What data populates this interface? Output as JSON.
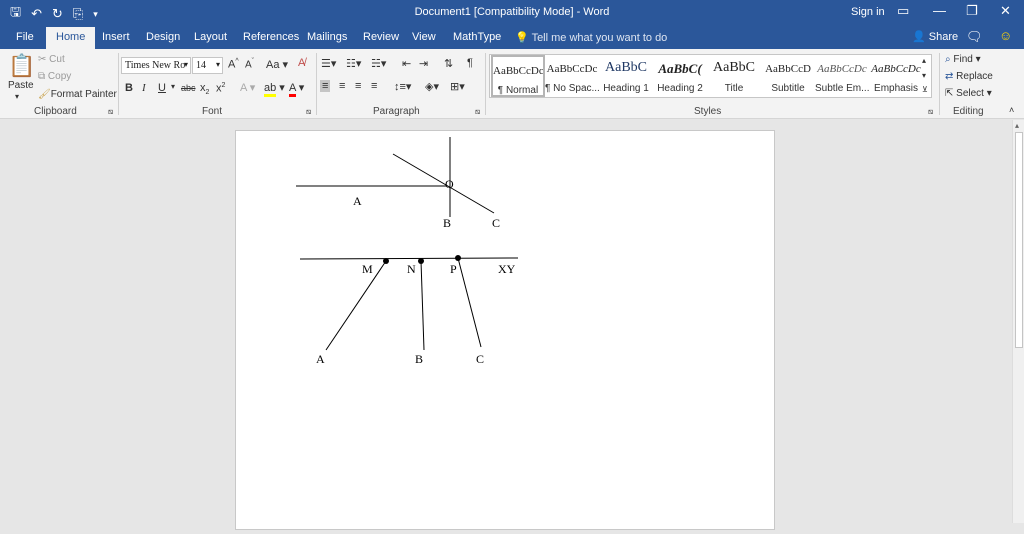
{
  "window": {
    "title": "Document1 [Compatibility Mode] - Word",
    "sign_in": "Sign in",
    "share": "Share",
    "tell_me": "Tell me what you want to do"
  },
  "tabs": [
    "File",
    "Home",
    "Insert",
    "Design",
    "Layout",
    "References",
    "Mailings",
    "Review",
    "View",
    "MathType"
  ],
  "clipboard": {
    "paste": "Paste",
    "cut": "Cut",
    "copy": "Copy",
    "format_painter": "Format Painter",
    "label": "Clipboard"
  },
  "font": {
    "name": "Times New Ro",
    "size": "14",
    "case": "Aa",
    "label": "Font"
  },
  "paragraph": {
    "label": "Paragraph"
  },
  "styles": {
    "label": "Styles",
    "items": [
      {
        "sample": "AaBbCcDc",
        "name": "¶ Normal"
      },
      {
        "sample": "AaBbCcDc",
        "name": "¶ No Spac..."
      },
      {
        "sample": "AaBbC",
        "name": "Heading 1"
      },
      {
        "sample": "AaBbC(",
        "name": "Heading 2"
      },
      {
        "sample": "AaBbC",
        "name": "Title"
      },
      {
        "sample": "AaBbCcD",
        "name": "Subtitle"
      },
      {
        "sample": "AaBbCcDc",
        "name": "Subtle Em..."
      },
      {
        "sample": "AaBbCcDc",
        "name": "Emphasis"
      }
    ]
  },
  "editing": {
    "find": "Find",
    "replace": "Replace",
    "select": "Select",
    "label": "Editing"
  },
  "figure1": {
    "o": "O",
    "a": "A",
    "b": "B",
    "c": "C"
  },
  "figure2": {
    "m": "M",
    "n": "N",
    "p": "P",
    "xy": "XY",
    "a": "A",
    "b": "B",
    "c": "C"
  },
  "colors": {
    "accent": "#2b579a",
    "highlight": "#ffff00",
    "font_color": "#ff0000"
  }
}
